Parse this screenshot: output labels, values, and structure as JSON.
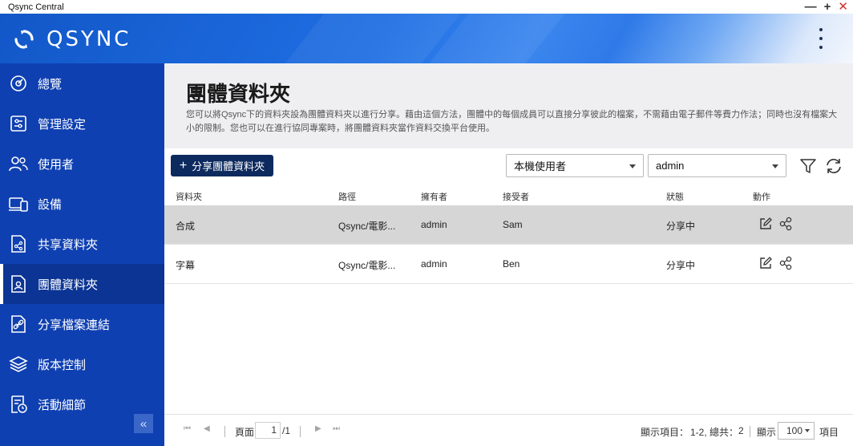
{
  "window": {
    "title": "Qsync Central",
    "minimize": "—",
    "maximize": "+",
    "close": "✕"
  },
  "header": {
    "brand": "QSYNC"
  },
  "sidebar": {
    "items": [
      {
        "label": "總覽",
        "icon": "overview-icon"
      },
      {
        "label": "管理設定",
        "icon": "settings-sliders-icon"
      },
      {
        "label": "使用者",
        "icon": "users-icon"
      },
      {
        "label": "設備",
        "icon": "devices-icon"
      },
      {
        "label": "共享資料夾",
        "icon": "shared-folder-icon"
      },
      {
        "label": "團體資料夾",
        "icon": "team-folder-icon"
      },
      {
        "label": "分享檔案連結",
        "icon": "share-link-icon"
      },
      {
        "label": "版本控制",
        "icon": "layers-icon"
      },
      {
        "label": "活動細節",
        "icon": "activity-log-icon"
      }
    ],
    "active_index": 5,
    "collapse_label": "«"
  },
  "main": {
    "title": "團體資料夾",
    "description": "您可以將Qsync下的資料夾設為團體資料夾以進行分享。藉由這個方法，團體中的每個成員可以直接分享彼此的檔案，不需藉由電子郵件等費力作法；同時也沒有檔案大小的限制。您也可以在進行協同專案時，將團體資料夾當作資料交換平台使用。",
    "add_button": "分享團體資料夾",
    "filter_source": "本機使用者",
    "filter_user": "admin"
  },
  "table": {
    "headers": {
      "folder": "資料夾",
      "path": "路徑",
      "owner": "擁有者",
      "recipient": "接受者",
      "status": "狀態",
      "action": "動作"
    },
    "rows": [
      {
        "folder": "合成",
        "path": "Qsync/電影...",
        "owner": "admin",
        "recipient": "Sam",
        "status": "分享中",
        "selected": true
      },
      {
        "folder": "字幕",
        "path": "Qsync/電影...",
        "owner": "admin",
        "recipient": "Ben",
        "status": "分享中",
        "selected": false
      }
    ]
  },
  "footer": {
    "page_label": "頁面",
    "page_value": "1",
    "page_total": "/1",
    "display_items_label": "顯示項目：",
    "display_range": "1-2, 總共：",
    "total": "2",
    "show_label": "顯示",
    "per_page": "100",
    "items_label": "項目",
    "first": "⏮",
    "prev": "◀",
    "next": "▶",
    "last": "⏭"
  }
}
